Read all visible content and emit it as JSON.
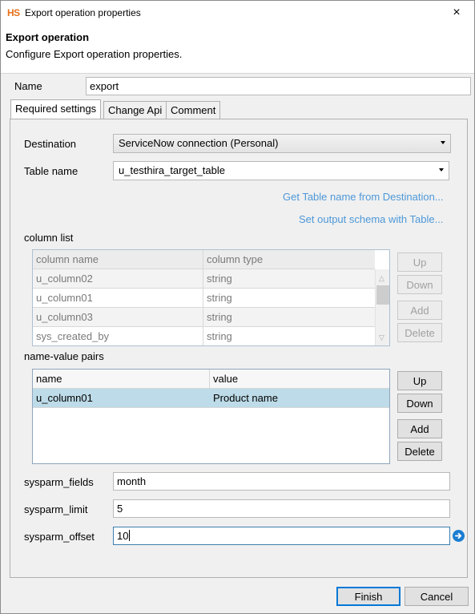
{
  "window": {
    "app_icon": "HS",
    "title": "Export operation properties",
    "close_icon": "×"
  },
  "header": {
    "title": "Export operation",
    "description": "Configure Export operation properties."
  },
  "name_field": {
    "label": "Name",
    "value": "export"
  },
  "tabs": [
    {
      "label": "Required settings",
      "active": true
    },
    {
      "label": "Change Api",
      "active": false
    },
    {
      "label": "Comment",
      "active": false
    }
  ],
  "destination": {
    "label": "Destination",
    "value": "ServiceNow connection (Personal)"
  },
  "table_name": {
    "label": "Table name",
    "value": "u_testhira_target_table"
  },
  "links": {
    "get_table_name": "Get Table name from Destination...",
    "set_output_schema": "Set output schema with Table..."
  },
  "column_list": {
    "label": "column list",
    "headers": [
      "column name",
      "column type"
    ],
    "rows": [
      [
        "u_column02",
        "string"
      ],
      [
        "u_column01",
        "string"
      ],
      [
        "u_column03",
        "string"
      ],
      [
        "sys_created_by",
        "string"
      ]
    ],
    "buttons": {
      "up": "Up",
      "down": "Down",
      "add": "Add",
      "delete": "Delete"
    }
  },
  "name_value_pairs": {
    "label": "name-value pairs",
    "headers": [
      "name",
      "value"
    ],
    "rows": [
      [
        "u_column01",
        "Product name"
      ]
    ],
    "buttons": {
      "up": "Up",
      "down": "Down",
      "add": "Add",
      "delete": "Delete"
    }
  },
  "sysparm_fields": {
    "label": "sysparm_fields",
    "value": "month"
  },
  "sysparm_limit": {
    "label": "sysparm_limit",
    "value": "5"
  },
  "sysparm_offset": {
    "label": "sysparm_offset",
    "value": "10"
  },
  "footer": {
    "finish": "Finish",
    "cancel": "Cancel"
  }
}
